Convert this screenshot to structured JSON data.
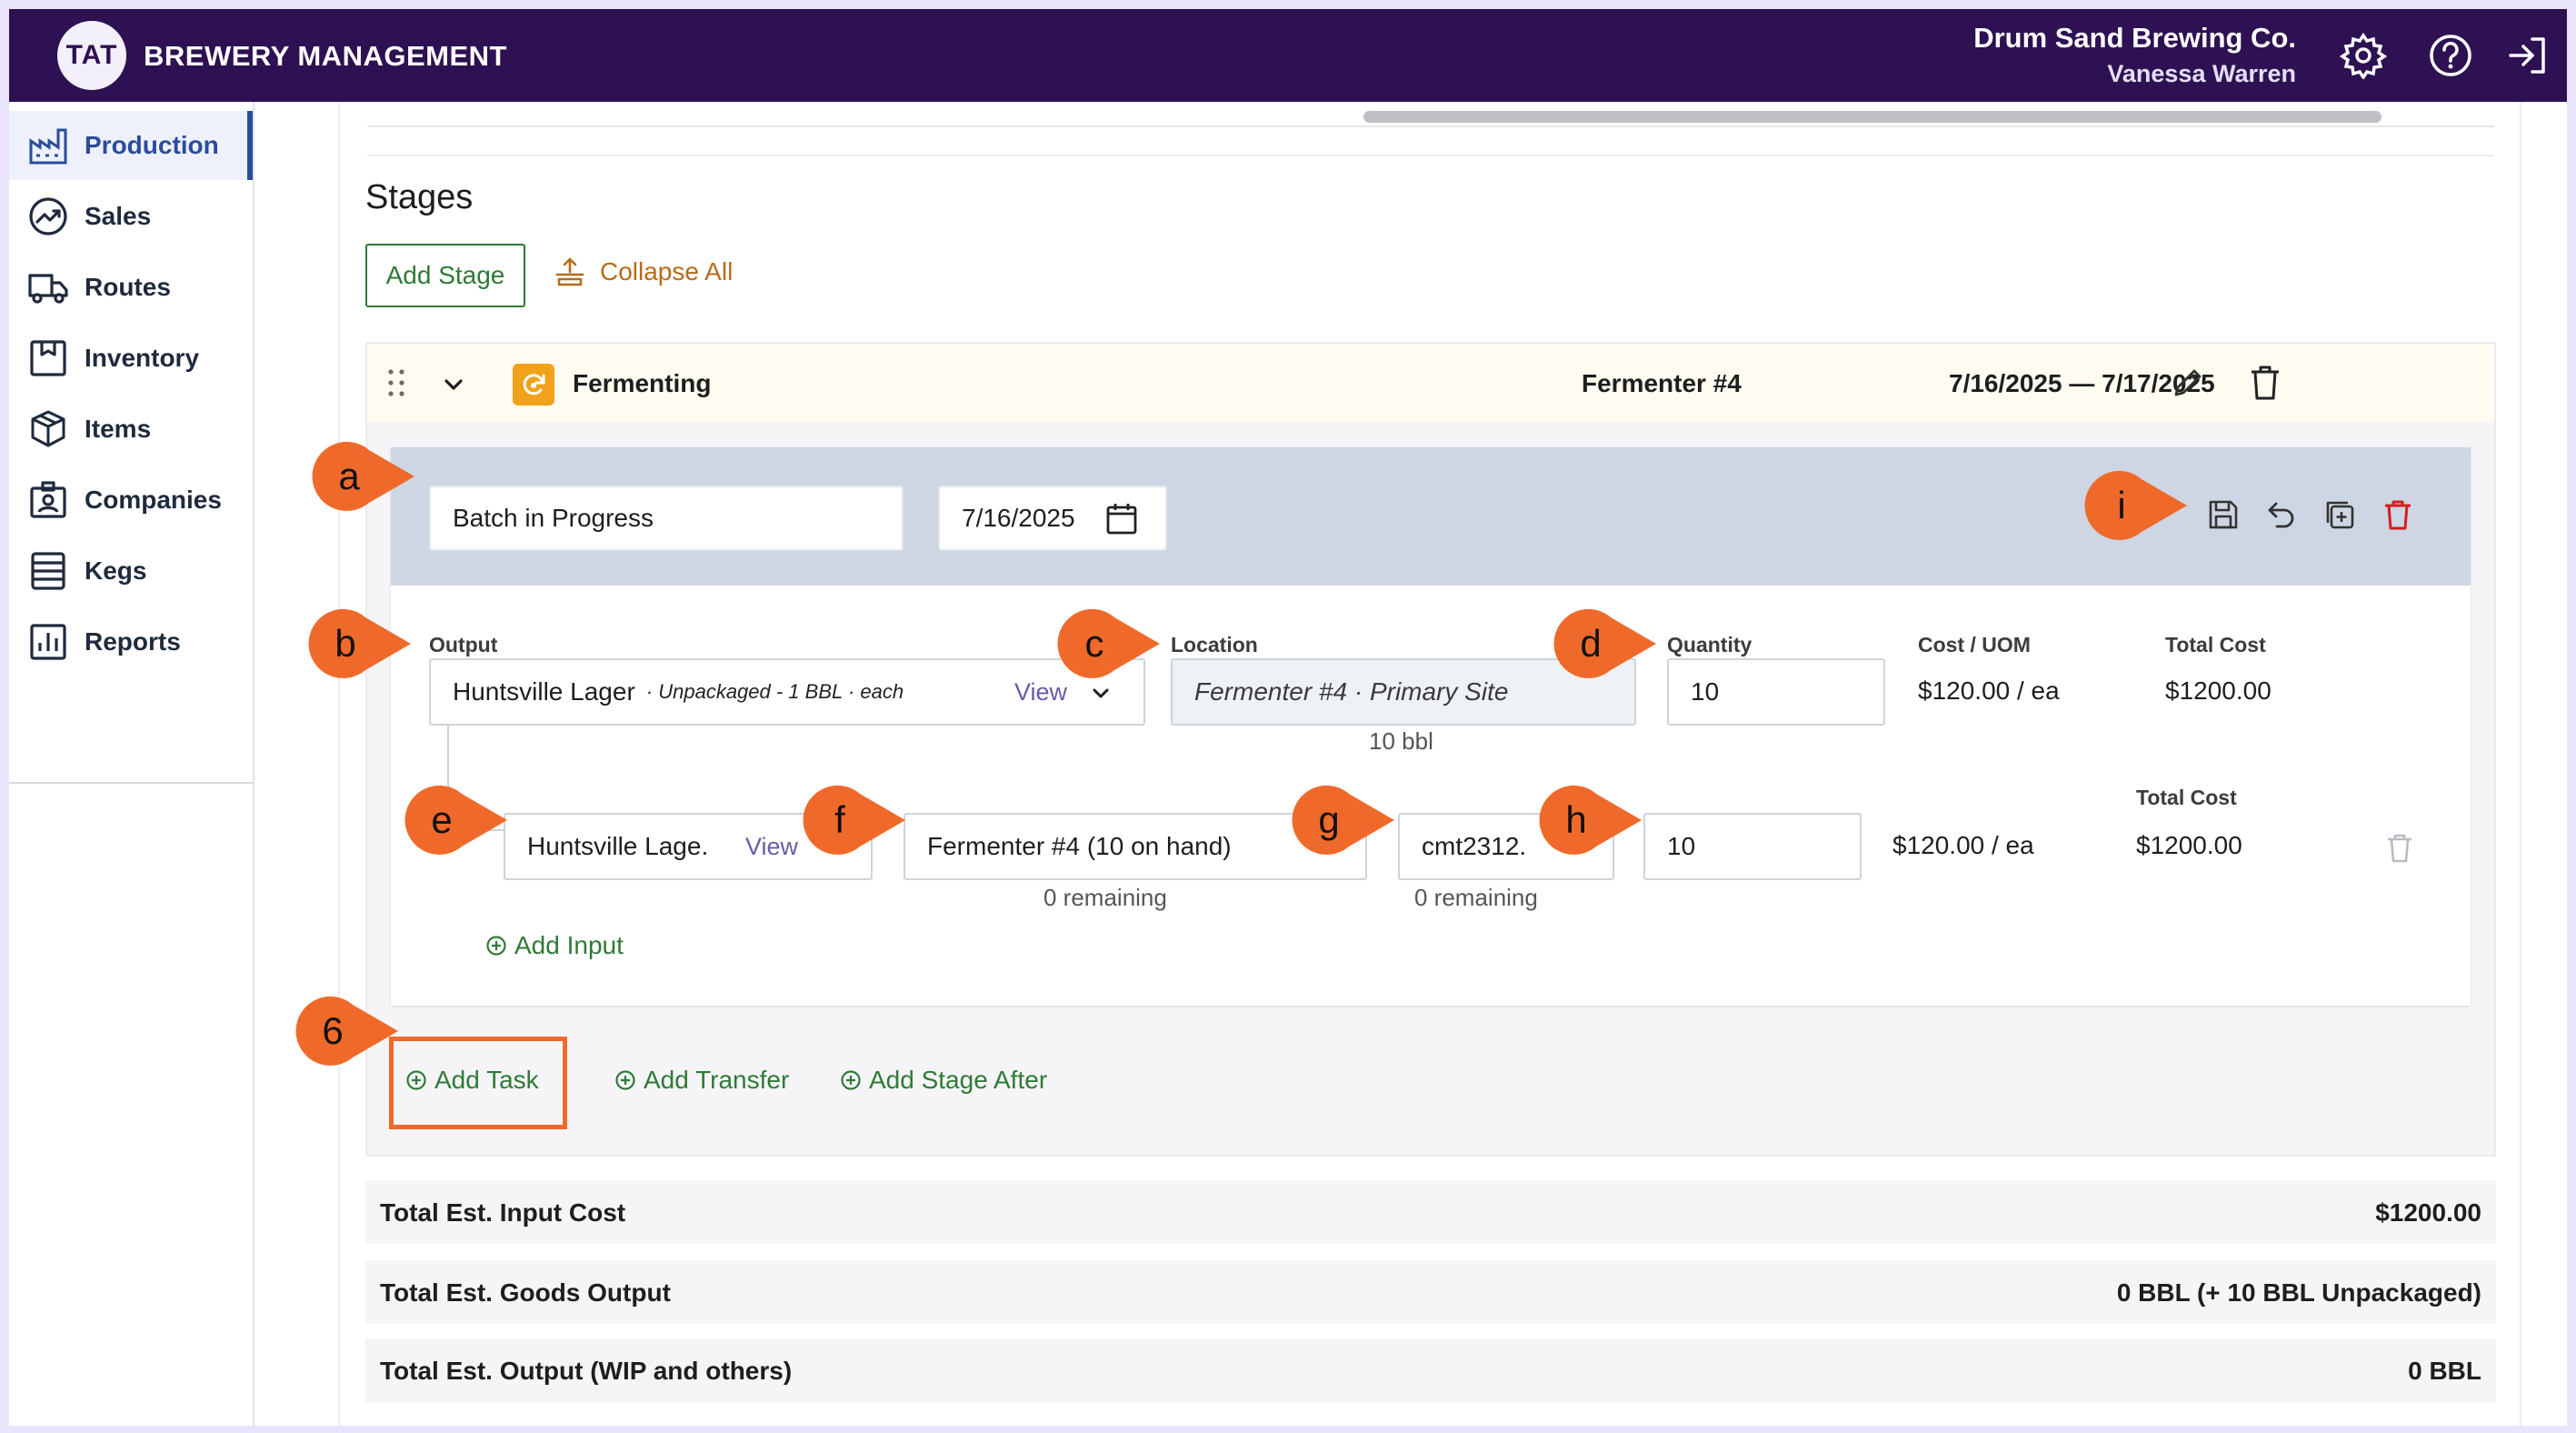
{
  "header": {
    "logo_text": "TAT",
    "app_name": "BREWERY MANAGEMENT",
    "company": "Drum Sand Brewing Co.",
    "user": "Vanessa Warren",
    "icons": [
      "gear-icon",
      "help-icon",
      "logout-icon"
    ]
  },
  "sidebar": {
    "items": [
      {
        "label": "Production",
        "icon": "factory-icon",
        "active": true
      },
      {
        "label": "Sales",
        "icon": "trend-icon"
      },
      {
        "label": "Routes",
        "icon": "truck-icon"
      },
      {
        "label": "Inventory",
        "icon": "inventory-icon"
      },
      {
        "label": "Items",
        "icon": "boxes-icon"
      },
      {
        "label": "Companies",
        "icon": "company-icon"
      },
      {
        "label": "Kegs",
        "icon": "keg-icon"
      },
      {
        "label": "Reports",
        "icon": "chart-icon"
      }
    ]
  },
  "stages": {
    "title": "Stages",
    "add_stage": "Add Stage",
    "collapse_all": "Collapse All",
    "stage": {
      "name": "Fermenting",
      "vessel": "Fermenter #4",
      "dates": "7/16/2025 — 7/17/2025",
      "accent": "#f1a21a"
    }
  },
  "task": {
    "name": "Batch in Progress",
    "date": "7/16/2025",
    "output_label": "Output",
    "location_label": "Location",
    "quantity_label": "Quantity",
    "cost_uom_label": "Cost / UOM",
    "total_cost_label": "Total Cost",
    "output_item": "Huntsville Lager",
    "output_sub": "· Unpackaged - 1 BBL · each",
    "view": "View",
    "location": "Fermenter #4 · Primary Site",
    "location_helper": "10 bbl",
    "quantity": "10",
    "cost_uom": "$120.00 / ea",
    "total_cost": "$1200.00",
    "input": {
      "item": "Huntsville Lage.",
      "view": "View",
      "vessel": "Fermenter #4 (10 on hand)",
      "vessel_helper": "0 remaining",
      "lot": "cmt2312.",
      "lot_helper": "0 remaining",
      "quantity": "10",
      "cost_uom": "$120.00 / ea",
      "total_cost_label": "Total Cost",
      "total_cost": "$1200.00"
    },
    "add_input": "Add Input"
  },
  "stage_actions": {
    "add_task": "Add Task",
    "add_transfer": "Add Transfer",
    "add_stage_after": "Add Stage After"
  },
  "totals": [
    {
      "label": "Total Est. Input Cost",
      "value": "$1200.00"
    },
    {
      "label": "Total Est. Goods Output",
      "value": "0 BBL (+ 10 BBL Unpackaged)"
    },
    {
      "label": "Total Est. Output (WIP and others)",
      "value": "0 BBL"
    }
  ],
  "callouts": {
    "a": "a",
    "b": "b",
    "c": "c",
    "d": "d",
    "e": "e",
    "f": "f",
    "g": "g",
    "h": "h",
    "i": "i",
    "six": "6"
  },
  "colors": {
    "header_bg": "#2d1152",
    "accent_green": "#2f7a36",
    "accent_orange": "#ef6a2a",
    "collapse_orange": "#b96a1a",
    "task_header_bg": "#cdd6e2"
  }
}
